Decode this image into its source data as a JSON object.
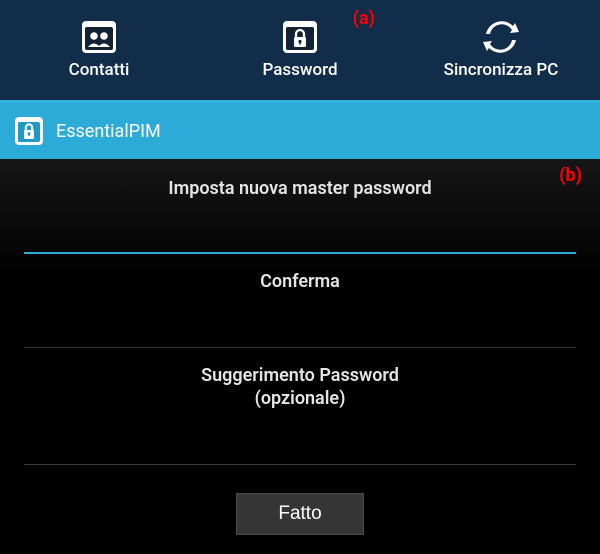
{
  "tabs": {
    "contacts": "Contatti",
    "password": "Password",
    "sync": "Sincronizza PC"
  },
  "markers": {
    "a": "(a)",
    "b": "(b)"
  },
  "titlebar": {
    "app_name": "EssentialPIM"
  },
  "form": {
    "new_password_label": "Imposta nuova master password",
    "confirm_label": "Conferma",
    "hint_label_line1": "Suggerimento Password",
    "hint_label_line2": "(opzionale)",
    "new_password_value": "",
    "confirm_value": "",
    "hint_value": "",
    "done_label": "Fatto"
  }
}
